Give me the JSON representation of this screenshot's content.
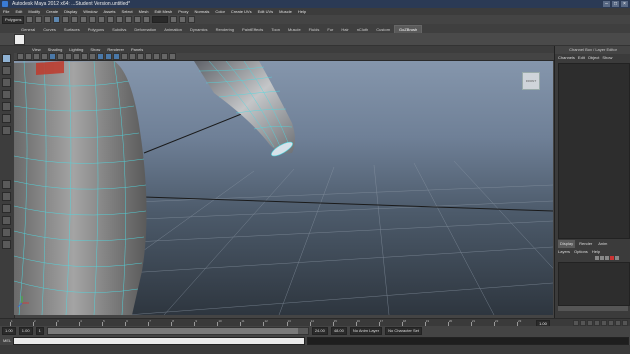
{
  "title_bar": {
    "title": "Autodesk Maya 2012 x64: ...Student Version.untitled*",
    "min_label": "–",
    "max_label": "□",
    "close_label": "×"
  },
  "menu": [
    "File",
    "Edit",
    "Modify",
    "Create",
    "Display",
    "Window",
    "Assets",
    "Select",
    "Mesh",
    "Edit Mesh",
    "Proxy",
    "Normals",
    "Color",
    "Create UVs",
    "Edit UVs",
    "Muscle",
    "Help"
  ],
  "status_line": {
    "menu_set": "Polygons"
  },
  "shelf_tabs": [
    "General",
    "Curves",
    "Surfaces",
    "Polygons",
    "Subdivs",
    "Deformation",
    "Animation",
    "Dynamics",
    "Rendering",
    "PaintEffects",
    "Toon",
    "Muscle",
    "Fluids",
    "Fur",
    "Hair",
    "nCloth",
    "Custom",
    "GoZBrush"
  ],
  "active_shelf_tab": "GoZBrush",
  "viewport_menu": [
    "View",
    "Shading",
    "Lighting",
    "Show",
    "Renderer",
    "Panels"
  ],
  "viewcube_label": "FRONT",
  "channel_box": {
    "title": "Channel Box / Layer Editor",
    "tabs": [
      "Channels",
      "Edit",
      "Object",
      "Show"
    ]
  },
  "layer_editor": {
    "tabs": [
      "Display",
      "Render",
      "Anim"
    ],
    "active_tab": "Display",
    "menu": [
      "Layers",
      "Options",
      "Help"
    ]
  },
  "timeline": {
    "tick_labels": [
      "1",
      "2",
      "3",
      "4",
      "5",
      "6",
      "7",
      "8",
      "9",
      "10",
      "11",
      "12",
      "13",
      "14",
      "15",
      "16",
      "17",
      "18",
      "19",
      "20",
      "21",
      "22",
      "23",
      "24"
    ],
    "current_frame": "1.00"
  },
  "range_slider": {
    "start_time": "1.00",
    "playback_start": "1.00",
    "playback_start_field": "1",
    "playback_end": "24.00",
    "end_time": "48.00",
    "anim_layer": "No Anim Layer",
    "character_set": "No Character Set"
  },
  "command_line": {
    "language": "MEL"
  }
}
